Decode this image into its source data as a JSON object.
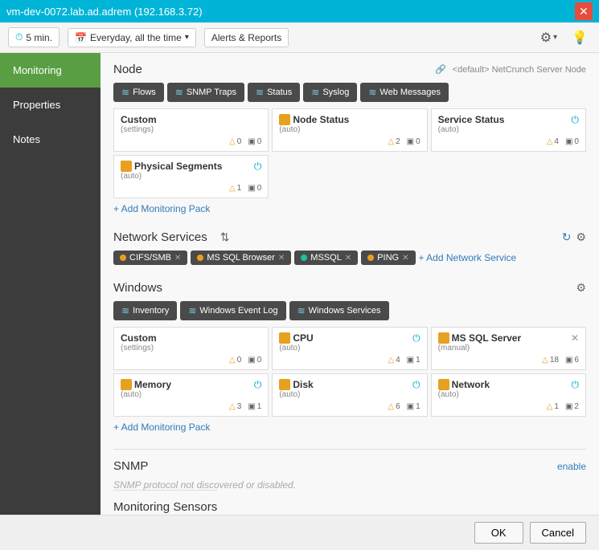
{
  "titleBar": {
    "title": "vm-dev-0072.lab.ad.adrem (192.168.3.72)",
    "closeLabel": "✕"
  },
  "toolbar": {
    "interval": "5 min.",
    "schedule": "Everyday, all the time",
    "scheduleDropdown": "▾",
    "alerts": "Alerts & Reports",
    "settingsIcon": "⚙",
    "lightbulbIcon": "💡"
  },
  "sidebar": {
    "items": [
      {
        "id": "monitoring",
        "label": "Monitoring",
        "active": true
      },
      {
        "id": "properties",
        "label": "Properties",
        "active": false
      },
      {
        "id": "notes",
        "label": "Notes",
        "active": false
      }
    ]
  },
  "node": {
    "sectionTitle": "Node",
    "linkIcon": "🔗",
    "linkText": "<default> NetCrunch Server Node",
    "tabs": [
      {
        "id": "flows",
        "label": "Flows"
      },
      {
        "id": "snmp-traps",
        "label": "SNMP Traps"
      },
      {
        "id": "status",
        "label": "Status"
      },
      {
        "id": "syslog",
        "label": "Syslog"
      },
      {
        "id": "web-messages",
        "label": "Web Messages"
      }
    ],
    "cards": [
      {
        "id": "custom",
        "title": "Custom",
        "sub": "(settings)",
        "icon": null,
        "iconColor": null,
        "powerIcon": false,
        "closeIcon": false,
        "stats": [
          {
            "icon": "△",
            "val": "0"
          },
          {
            "icon": "▣",
            "val": "0"
          }
        ]
      },
      {
        "id": "node-status",
        "title": "Node Status",
        "sub": "(auto)",
        "icon": "yellow",
        "powerIcon": false,
        "closeIcon": false,
        "stats": [
          {
            "icon": "△",
            "val": "2"
          },
          {
            "icon": "▣",
            "val": "0"
          }
        ]
      },
      {
        "id": "service-status",
        "title": "Service Status",
        "sub": "(auto)",
        "icon": null,
        "powerIcon": true,
        "closeIcon": false,
        "stats": [
          {
            "icon": "△",
            "val": "4"
          },
          {
            "icon": "▣",
            "val": "0"
          }
        ]
      },
      {
        "id": "physical-segments",
        "title": "Physical Segments",
        "sub": "(auto)",
        "icon": "yellow",
        "powerIcon": true,
        "closeIcon": false,
        "stats": [
          {
            "icon": "△",
            "val": "1"
          },
          {
            "icon": "▣",
            "val": "0"
          }
        ]
      }
    ],
    "addMonitoringPackLabel": "+ Add Monitoring Pack"
  },
  "networkServices": {
    "sectionTitle": "Network Services",
    "tags": [
      {
        "id": "cifs-smb",
        "label": "CIFS/SMB",
        "dotColor": "yellow",
        "removable": true
      },
      {
        "id": "ms-sql-browser",
        "label": "MS SQL Browser",
        "dotColor": "yellow",
        "removable": true
      },
      {
        "id": "mssql",
        "label": "MSSQL",
        "dotColor": "teal",
        "removable": true
      },
      {
        "id": "ping",
        "label": "PING",
        "dotColor": "yellow",
        "removable": true
      }
    ],
    "addServiceLabel": "+ Add Network Service"
  },
  "windows": {
    "sectionTitle": "Windows",
    "tabs": [
      {
        "id": "inventory",
        "label": "Inventory"
      },
      {
        "id": "windows-event-log",
        "label": "Windows Event Log"
      },
      {
        "id": "windows-services",
        "label": "Windows Services"
      }
    ],
    "cards": [
      {
        "id": "custom-win",
        "title": "Custom",
        "sub": "(settings)",
        "icon": null,
        "powerIcon": false,
        "closeIcon": false,
        "stats": [
          {
            "icon": "△",
            "val": "0"
          },
          {
            "icon": "▣",
            "val": "0"
          }
        ]
      },
      {
        "id": "cpu",
        "title": "CPU",
        "sub": "(auto)",
        "icon": "yellow",
        "powerIcon": true,
        "closeIcon": false,
        "stats": [
          {
            "icon": "△",
            "val": "4"
          },
          {
            "icon": "▣",
            "val": "1"
          }
        ]
      },
      {
        "id": "ms-sql-server",
        "title": "MS SQL Server",
        "sub": "(manual)",
        "icon": "yellow",
        "powerIcon": false,
        "closeIcon": true,
        "stats": [
          {
            "icon": "△",
            "val": "18"
          },
          {
            "icon": "▣",
            "val": "6"
          }
        ]
      },
      {
        "id": "memory",
        "title": "Memory",
        "sub": "(auto)",
        "icon": "yellow",
        "powerIcon": true,
        "closeIcon": false,
        "stats": [
          {
            "icon": "△",
            "val": "3"
          },
          {
            "icon": "▣",
            "val": "1"
          }
        ]
      },
      {
        "id": "disk",
        "title": "Disk",
        "sub": "(auto)",
        "icon": "yellow",
        "powerIcon": true,
        "closeIcon": false,
        "stats": [
          {
            "icon": "△",
            "val": "6"
          },
          {
            "icon": "▣",
            "val": "1"
          }
        ]
      },
      {
        "id": "network",
        "title": "Network",
        "sub": "(auto)",
        "icon": "yellow",
        "powerIcon": true,
        "closeIcon": false,
        "stats": [
          {
            "icon": "△",
            "val": "1"
          },
          {
            "icon": "▣",
            "val": "2"
          }
        ]
      }
    ],
    "addMonitoringPackLabel": "+ Add Monitoring Pack"
  },
  "snmp": {
    "sectionTitle": "SNMP",
    "enableLabel": "enable",
    "description": "SNMP protocol not discovered or disabled."
  },
  "monitoringSensors": {
    "sectionTitle": "Monitoring Sensors"
  },
  "bottomBar": {
    "okLabel": "OK",
    "cancelLabel": "Cancel"
  }
}
